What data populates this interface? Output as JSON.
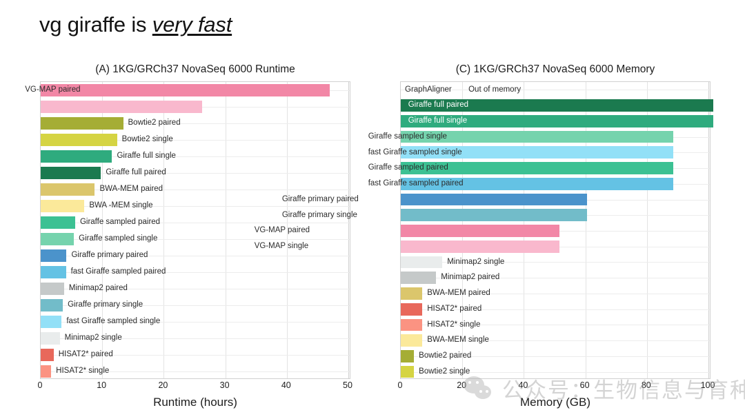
{
  "slide": {
    "title_plain": "vg giraffe is ",
    "title_emphasis": "very fast"
  },
  "watermark": {
    "text": "公众号：生物信息与育种",
    "icon": "wechat-icon"
  },
  "colors": {
    "vgmap_paired": "#f287a6",
    "vgmap_single": "#f9b8cd",
    "bowtie2_paired": "#a5ad35",
    "bowtie2_single": "#d5d443",
    "giraffe_full_single": "#2fab7e",
    "giraffe_full_paired": "#1b7a4f",
    "bwamem_paired": "#dbc66c",
    "bwamem_single": "#fbe99a",
    "giraffe_sampled_paired": "#3cc193",
    "giraffe_sampled_single": "#75d3ad",
    "giraffe_primary_paired": "#4b93cb",
    "giraffe_primary_single": "#72bcc9",
    "fast_giraffe_sampled_paired": "#64c2e4",
    "fast_giraffe_sampled_single": "#92e0f7",
    "minimap2_paired": "#c5c9c9",
    "minimap2_single": "#e9ecec",
    "hisat2_paired": "#e8685b",
    "hisat2_single": "#fb9382",
    "gridline": "#e3e3e3",
    "plot_border": "#d0d0d0"
  },
  "chart_data": [
    {
      "id": "panel-a",
      "type": "bar",
      "orientation": "horizontal",
      "title": "(A) 1KG/GRCh37 NovaSeq 6000 Runtime",
      "xlabel": "Runtime (hours)",
      "ylabel": "",
      "xlim": [
        0,
        50
      ],
      "xticks": [
        0,
        10,
        20,
        30,
        40,
        50
      ],
      "grid": true,
      "legend": "none",
      "categories": [
        "VG-MAP paired",
        "VG-MAP single",
        "Bowtie2 paired",
        "Bowtie2 single",
        "Giraffe full single",
        "Giraffe full paired",
        "BWA-MEM paired",
        "BWA -MEM single",
        "Giraffe sampled paired",
        "Giraffe sampled single",
        "Giraffe primary paired",
        "fast Giraffe sampled paired",
        "Minimap2 paired",
        "Giraffe primary single",
        "fast Giraffe sampled single",
        "Minimap2 single",
        "HISAT2* paired",
        "HISAT2* single"
      ],
      "values": [
        47.0,
        26.2,
        13.4,
        12.4,
        11.6,
        9.8,
        8.8,
        7.1,
        5.6,
        5.4,
        4.2,
        4.1,
        3.8,
        3.6,
        3.4,
        3.1,
        2.1,
        1.7
      ],
      "bar_colors": [
        "#f287a6",
        "#f9b8cd",
        "#a5ad35",
        "#d5d443",
        "#2fab7e",
        "#1b7a4f",
        "#dbc66c",
        "#fbe99a",
        "#3cc193",
        "#75d3ad",
        "#4b93cb",
        "#64c2e4",
        "#c5c9c9",
        "#72bcc9",
        "#92e0f7",
        "#e9ecec",
        "#e8685b",
        "#fb9382"
      ],
      "label_placement": [
        "inside",
        "inside",
        "outside",
        "outside",
        "outside",
        "outside",
        "outside",
        "outside",
        "outside",
        "outside",
        "outside",
        "outside",
        "outside",
        "outside",
        "outside",
        "outside",
        "outside",
        "outside"
      ]
    },
    {
      "id": "panel-c",
      "type": "bar",
      "orientation": "horizontal",
      "title": "(C) 1KG/GRCh37 NovaSeq 6000 Memory",
      "xlabel": "Memory (GB)",
      "ylabel": "",
      "xlim": [
        0,
        100
      ],
      "xticks": [
        0,
        20,
        40,
        60,
        80,
        100
      ],
      "grid": true,
      "legend": "none",
      "annotation": {
        "category": "GraphAligner",
        "text": "Out of memory",
        "value": null
      },
      "categories": [
        "GraphAligner",
        "Giraffe full paired",
        "Giraffe full single",
        "Giraffe sampled single",
        "fast Giraffe sampled single",
        "Giraffe sampled paired",
        "fast Giraffe sampled paired",
        "Giraffe primary paired",
        "Giraffe primary single",
        "VG-MAP paired",
        "VG-MAP single",
        "Minimap2 single",
        "Minimap2 paired",
        "BWA-MEM paired",
        "HISAT2* paired",
        "HISAT2* single",
        "BWA-MEM single",
        "Bowtie2 paired",
        "Bowtie2 single"
      ],
      "values": [
        0,
        101.5,
        101.5,
        88.5,
        88.5,
        88.5,
        88.5,
        60.5,
        60.5,
        51.5,
        51.5,
        13.5,
        11.5,
        7.0,
        7.0,
        7.0,
        7.0,
        4.3,
        4.3
      ],
      "bar_colors": [
        "#ffffff",
        "#1b7a4f",
        "#2fab7e",
        "#75d3ad",
        "#92e0f7",
        "#3cc193",
        "#64c2e4",
        "#4b93cb",
        "#72bcc9",
        "#f287a6",
        "#f9b8cd",
        "#e9ecec",
        "#c5c9c9",
        "#dbc66c",
        "#e8685b",
        "#fb9382",
        "#fbe99a",
        "#a5ad35",
        "#d5d443"
      ],
      "label_placement": [
        "annotation",
        "inside-light",
        "inside-light",
        "inside",
        "inside",
        "inside",
        "inside",
        "inside",
        "inside",
        "inside",
        "inside",
        "outside",
        "outside",
        "outside",
        "outside",
        "outside",
        "outside",
        "outside",
        "outside"
      ]
    }
  ]
}
